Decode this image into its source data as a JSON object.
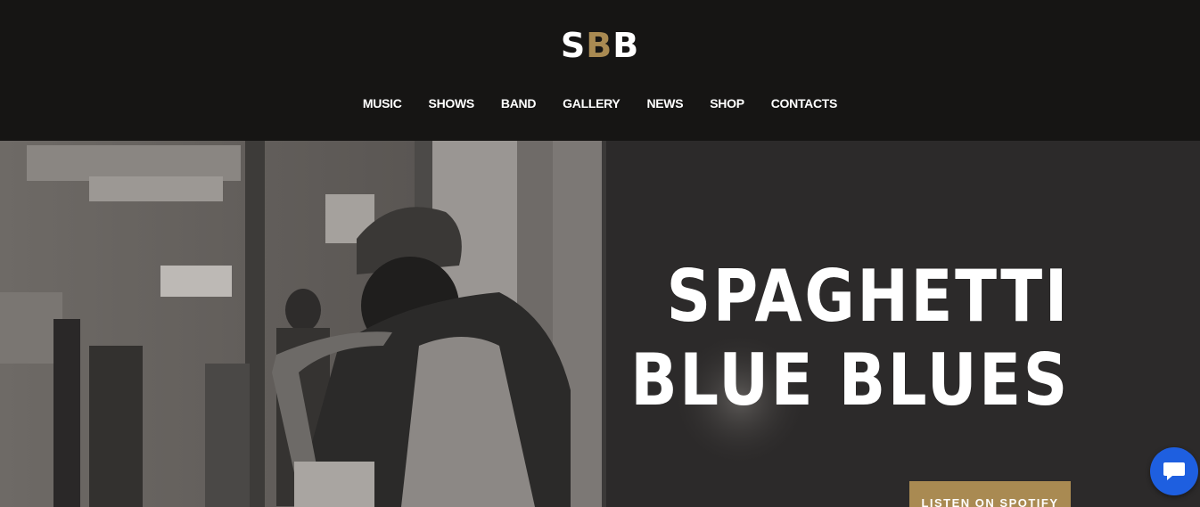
{
  "logo": {
    "part1": "S",
    "part2": "B",
    "part3": "B",
    "accent_color": "#a98a52"
  },
  "nav": {
    "items": [
      "MUSIC",
      "SHOWS",
      "BAND",
      "GALLERY",
      "NEWS",
      "SHOP",
      "CONTACTS"
    ]
  },
  "hero": {
    "title_line1": "SPAGHETTI",
    "title_line2": "BLUE BLUES",
    "cta_label": "LISTEN ON SPOTIFY"
  },
  "chat": {
    "icon": "chat-bubble-icon",
    "color": "#1e5fe0"
  }
}
